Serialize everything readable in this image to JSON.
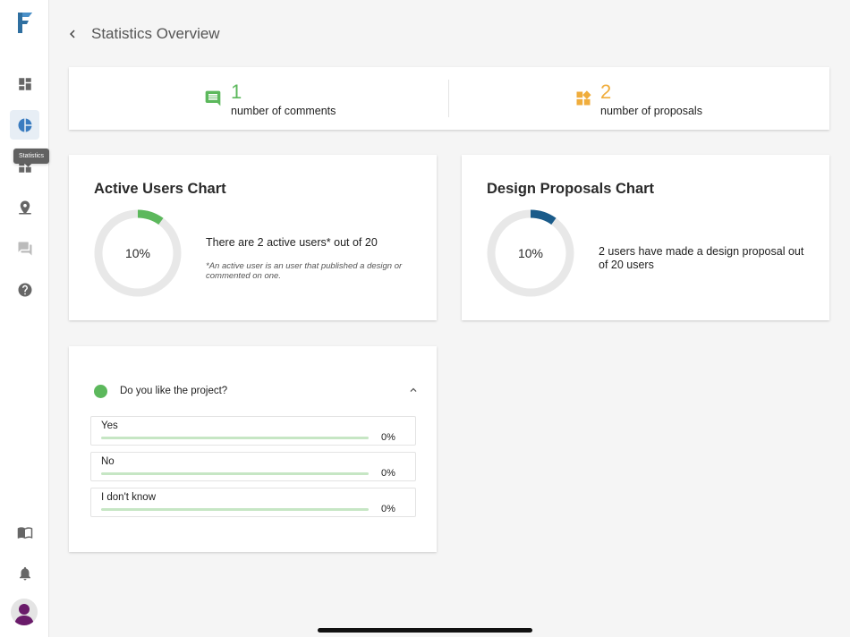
{
  "colors": {
    "brand": "#2f6fa0",
    "green": "#5cb85c",
    "orange": "#f0ad3c",
    "blue": "#1a5b8a",
    "icon_gray": "#666666"
  },
  "sidebar": {
    "logo_icon": "f-logo-icon",
    "items": [
      {
        "name": "dashboard",
        "icon": "dashboard-icon"
      },
      {
        "name": "statistics",
        "icon": "pie-chart-icon",
        "active": true
      },
      {
        "name": "widgets",
        "icon": "widgets-icon"
      },
      {
        "name": "map",
        "icon": "location-icon"
      },
      {
        "name": "comments",
        "icon": "forum-icon"
      },
      {
        "name": "help",
        "icon": "help-icon"
      }
    ],
    "tooltip": "Statistics",
    "bottom": [
      {
        "name": "guide",
        "icon": "book-icon"
      },
      {
        "name": "notifications",
        "icon": "bell-icon"
      }
    ]
  },
  "header": {
    "title": "Statistics Overview"
  },
  "stats": {
    "comments": {
      "value": "1",
      "label": "number of comments",
      "icon": "comment-icon"
    },
    "proposals": {
      "value": "2",
      "label": "number of proposals",
      "icon": "widgets-icon"
    }
  },
  "active_users": {
    "title": "Active Users Chart",
    "percent_label": "10%",
    "percent": 10,
    "text": "There are 2 active users* out of 20",
    "note": "*An active user is an user that published a design or commented on one."
  },
  "design_proposals": {
    "title": "Design Proposals Chart",
    "percent_label": "10%",
    "percent": 10,
    "text": "2 users have made a design proposal out of 20 users"
  },
  "poll": {
    "question": "Do you like the project?",
    "options": [
      {
        "label": "Yes",
        "percent_label": "0%",
        "percent": 0
      },
      {
        "label": "No",
        "percent_label": "0%",
        "percent": 0
      },
      {
        "label": "I don't know",
        "percent_label": "0%",
        "percent": 0
      }
    ]
  }
}
